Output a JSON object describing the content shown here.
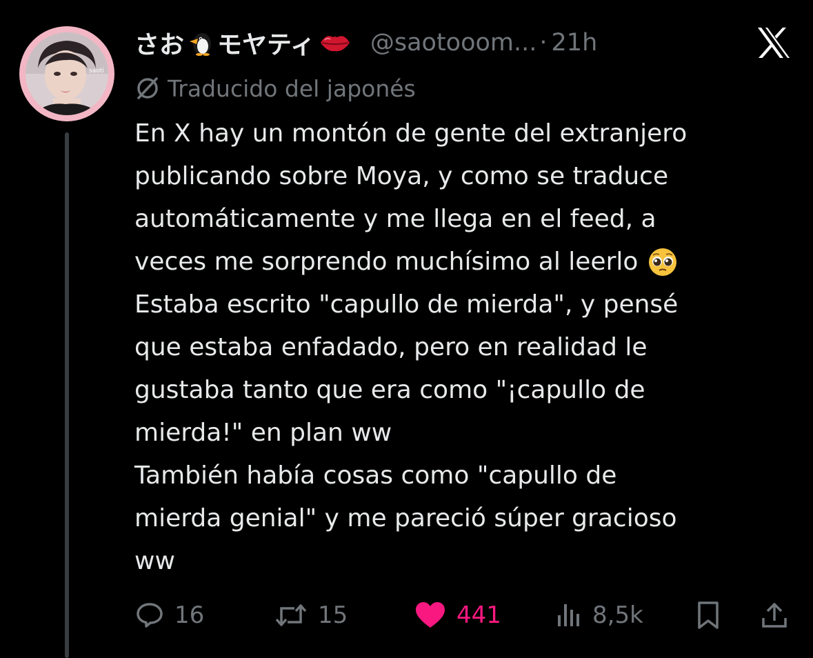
{
  "post": {
    "display_name": "さお",
    "display_name_suffix": "モヤティ",
    "handle": "@saotooom...",
    "separator": "·",
    "time": "21h",
    "translation_label": "Traducido del japonés",
    "text_lines": [
      "En X hay un montón de gente del extranjero",
      "publicando sobre Moya, y como se traduce",
      "automáticamente y me llega en el feed, a",
      "veces me sorprendo muchísimo al leerlo",
      "Estaba escrito \"capullo de mierda\", y pensé",
      "que estaba enfadado, pero en realidad le",
      "gustaba tanto que era como \"¡capullo de",
      "mierda!\" en plan ww",
      "También había cosas como \"capullo de",
      "mierda genial\" y me pareció súper gracioso",
      "ww"
    ]
  },
  "icons": {
    "name_icon_1": "penguin-icon",
    "name_icon_2": "kiss-lips-icon",
    "text_emoji": "pleading-face-icon",
    "brand": "x-logo-icon",
    "translation": "translate-icon"
  },
  "actions": {
    "reply_count": "16",
    "retweet_count": "15",
    "like_count": "441",
    "views_count": "8,5k"
  },
  "colors": {
    "background": "#000000",
    "text": "#e7e9ea",
    "secondary": "#71767b",
    "like": "#f91880",
    "avatar_ring": "#f2b6c4"
  }
}
